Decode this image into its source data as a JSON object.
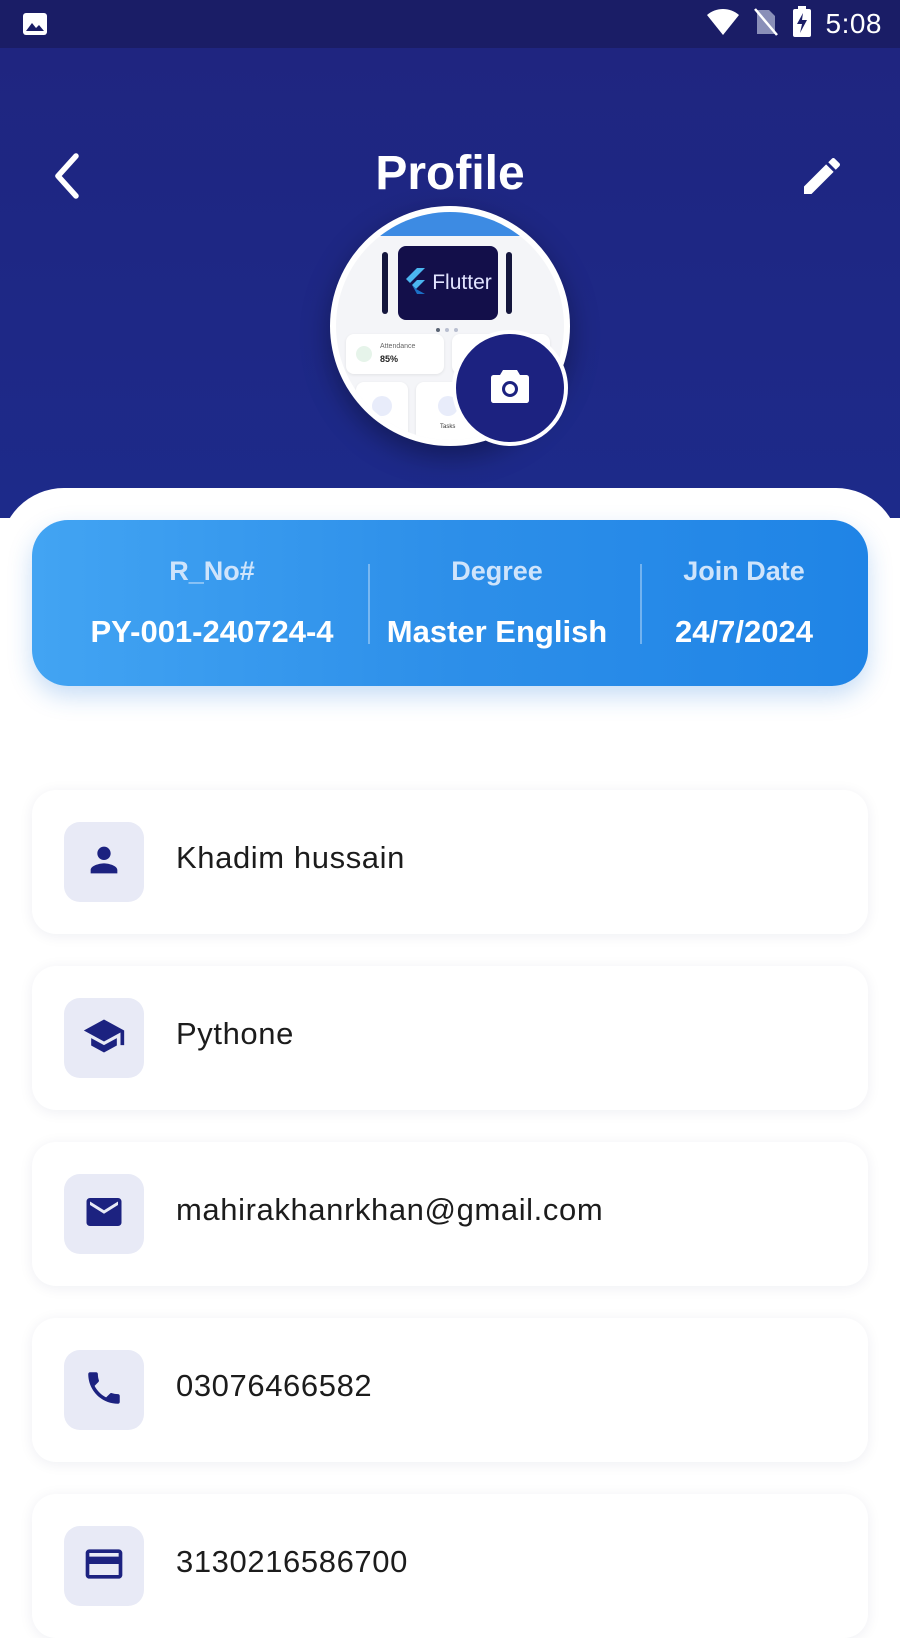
{
  "status_bar": {
    "time": "5:08",
    "icons": [
      "image-icon",
      "wifi-icon",
      "no-sim-icon",
      "battery-charging-icon"
    ]
  },
  "header": {
    "title": "Profile",
    "back_icon": "chevron-left-icon",
    "edit_icon": "pencil-icon"
  },
  "avatar": {
    "banner_text": "Flutter",
    "card_label": "Attendance",
    "card_value": "85%",
    "tasks_label": "Tasks",
    "camera_icon": "camera-icon"
  },
  "info_card": {
    "columns": [
      {
        "label": "R_No#",
        "value": "PY-001-240724-4"
      },
      {
        "label": "Degree",
        "value": "Master English"
      },
      {
        "label": "Join Date",
        "value": "24/7/2024"
      }
    ]
  },
  "details": [
    {
      "icon": "person-icon",
      "value": "Khadim hussain"
    },
    {
      "icon": "graduation-cap-icon",
      "value": "Pythone"
    },
    {
      "icon": "email-icon",
      "value": "mahirakhanrkhan@gmail.com"
    },
    {
      "icon": "phone-icon",
      "value": "03076466582"
    },
    {
      "icon": "credit-card-icon",
      "value": "3130216586700"
    }
  ],
  "colors": {
    "primary": "#1f2580",
    "accent_gradient_start": "#42a4f3",
    "accent_gradient_end": "#1f84e6",
    "icon_bg": "#e8eaf6"
  }
}
